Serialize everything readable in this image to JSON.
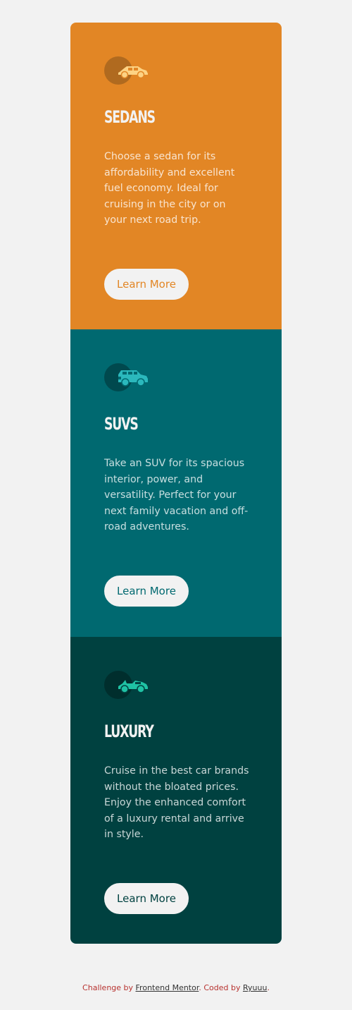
{
  "cards": [
    {
      "icon": "sedan-car-icon",
      "title": "Sedans",
      "description": "Choose a sedan for its affordability and excellent fuel economy. Ideal for cruising in the city or on your next road trip.",
      "button_label": "Learn More",
      "color": "#e28625"
    },
    {
      "icon": "suv-car-icon",
      "title": "SUVs",
      "description": "Take an SUV for its spacious interior, power, and versatility. Perfect for your next family vacation and off-road adventures.",
      "button_label": "Learn More",
      "color": "#006970"
    },
    {
      "icon": "luxury-car-icon",
      "title": "Luxury",
      "description": "Cruise in the best car brands without the bloated prices. Enjoy the enhanced comfort of a luxury rental and arrive in style.",
      "button_label": "Learn More",
      "color": "#004140"
    }
  ],
  "footer": {
    "prefix": "Challenge by ",
    "link1": "Frontend Mentor",
    "middle": ". Coded by ",
    "link2": "Ryuuu",
    "suffix": "."
  },
  "colors": {
    "background": "#f2f2f2",
    "accent_text": "#b7322f"
  }
}
